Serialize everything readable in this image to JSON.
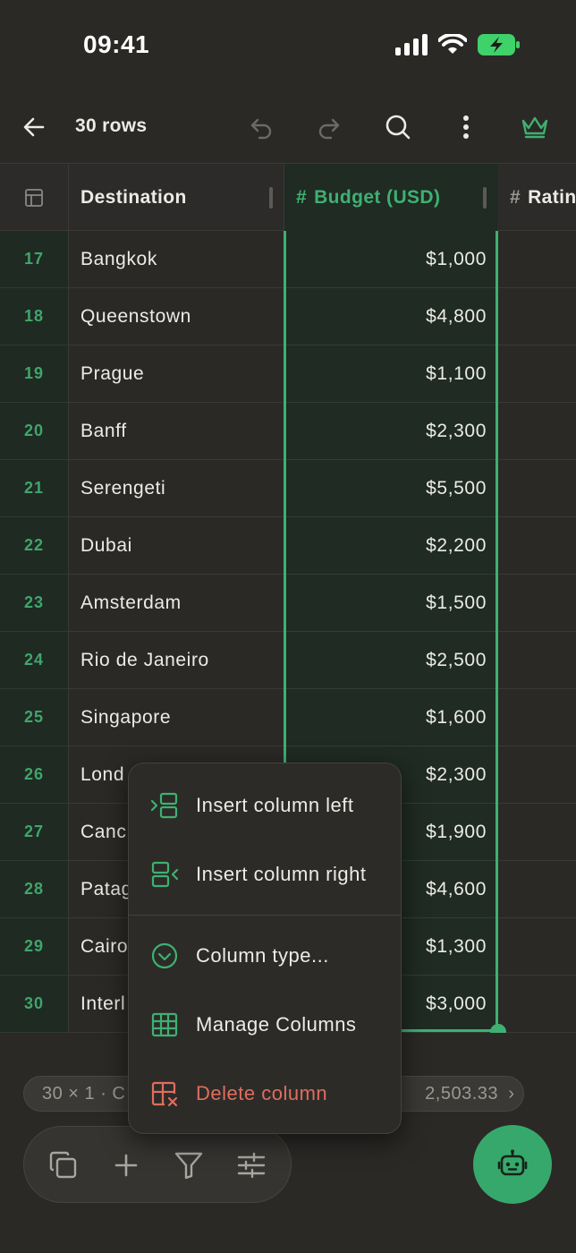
{
  "status_bar": {
    "time": "09:41"
  },
  "toolbar": {
    "title": "30 rows"
  },
  "columns": {
    "destination": "Destination",
    "budget": "Budget (USD)",
    "rating": "Ratin",
    "hash": "#"
  },
  "rows": [
    {
      "num": "17",
      "dest": "Bangkok",
      "budget": "$1,000"
    },
    {
      "num": "18",
      "dest": "Queenstown",
      "budget": "$4,800"
    },
    {
      "num": "19",
      "dest": "Prague",
      "budget": "$1,100"
    },
    {
      "num": "20",
      "dest": "Banff",
      "budget": "$2,300"
    },
    {
      "num": "21",
      "dest": "Serengeti",
      "budget": "$5,500"
    },
    {
      "num": "22",
      "dest": "Dubai",
      "budget": "$2,200"
    },
    {
      "num": "23",
      "dest": "Amsterdam",
      "budget": "$1,500"
    },
    {
      "num": "24",
      "dest": "Rio de Janeiro",
      "budget": "$2,500"
    },
    {
      "num": "25",
      "dest": "Singapore",
      "budget": "$1,600"
    },
    {
      "num": "26",
      "dest": "Lond",
      "budget": "$2,300"
    },
    {
      "num": "27",
      "dest": "Canc",
      "budget": "$1,900"
    },
    {
      "num": "28",
      "dest": "Patag",
      "budget": "$4,600"
    },
    {
      "num": "29",
      "dest": "Cairo",
      "budget": "$1,300"
    },
    {
      "num": "30",
      "dest": "Interl",
      "budget": "$3,000"
    }
  ],
  "summary": {
    "left": "30 × 1 · C",
    "right": "2,503.33",
    "chevron": "›"
  },
  "context_menu": {
    "insert_left": "Insert column left",
    "insert_right": "Insert column right",
    "column_type": "Column type...",
    "manage_columns": "Manage Columns",
    "delete_column": "Delete column"
  },
  "colors": {
    "accent": "#3fb071",
    "danger": "#e06d5e",
    "background": "#2a2926",
    "selected_column": "#1f2b23"
  },
  "icons": {
    "toolbar": [
      "back-arrow-icon",
      "undo-icon",
      "redo-icon",
      "search-icon",
      "more-vertical-icon",
      "crown-icon"
    ],
    "action_bar": [
      "copy-icon",
      "plus-icon",
      "filter-icon",
      "sliders-icon"
    ],
    "fab": "robot-icon"
  }
}
